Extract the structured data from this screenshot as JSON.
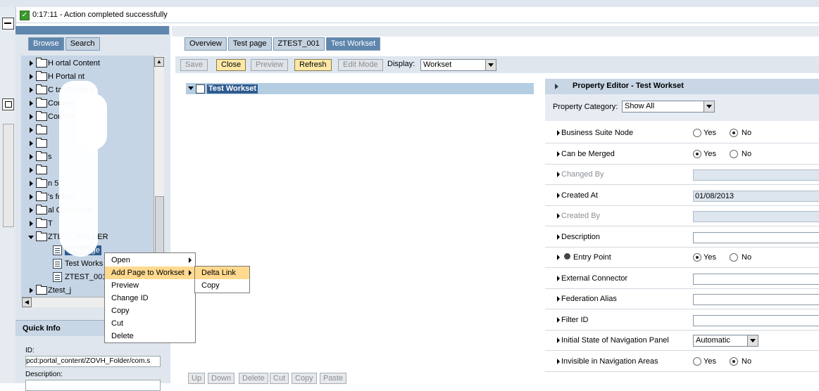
{
  "status": {
    "message": "0:17:11 - Action completed successfully"
  },
  "left_tabs": [
    "Browse",
    "Search"
  ],
  "tree": {
    "items": [
      {
        "label": "H    ortal Content",
        "type": "folder",
        "expanded": false
      },
      {
        "label": "H    Portal     nt",
        "type": "folder",
        "expanded": false
      },
      {
        "label": "      C     tal Content",
        "type": "folder",
        "expanded": false
      },
      {
        "label": "         Content",
        "type": "folder",
        "expanded": false
      },
      {
        "label": "             Content",
        "type": "folder",
        "expanded": false
      },
      {
        "label": "",
        "type": "folder",
        "expanded": false
      },
      {
        "label": "",
        "type": "folder",
        "expanded": false
      },
      {
        "label": "        s",
        "type": "folder",
        "expanded": false
      },
      {
        "label": "",
        "type": "folder",
        "expanded": false
      },
      {
        "label": "        n 5.0",
        "type": "folder",
        "expanded": false
      },
      {
        "label": "      's folder",
        "type": "folder",
        "expanded": false
      },
      {
        "label": "   al Composer",
        "type": "folder",
        "expanded": false
      },
      {
        "label": "              T",
        "type": "folder",
        "expanded": false
      },
      {
        "label": "ZTEST_FOLDER",
        "type": "folder",
        "expanded": true
      },
      {
        "label": "Test page",
        "type": "page",
        "selected": true
      },
      {
        "label": "Test Works",
        "type": "workset"
      },
      {
        "label": "ZTEST_001",
        "type": "iview"
      },
      {
        "label": "Ztest_j",
        "type": "folder",
        "expanded": false
      }
    ]
  },
  "quick_info": {
    "title": "Quick Info",
    "id_label": "ID:",
    "id_value": "pcd:portal_content/ZOVH_Folder/com.s",
    "desc_label": "Description:"
  },
  "context_menu": {
    "items": [
      "Open",
      "Add Page to Workset",
      "Preview",
      "Change ID",
      "Copy",
      "Cut",
      "Delete"
    ],
    "submenu": [
      "Delta Link",
      "Copy"
    ]
  },
  "right_tabs": [
    "Overview",
    "Test page",
    "ZTEST_001",
    "Test Workset"
  ],
  "toolbar": {
    "save": "Save",
    "close": "Close",
    "preview": "Preview",
    "refresh": "Refresh",
    "edit_mode": "Edit Mode",
    "display_label": "Display:",
    "display_value": "Workset"
  },
  "workset_tree": {
    "root": "Test Workset"
  },
  "bottom_buttons": [
    "Up",
    "Down",
    "Delete",
    "Cut",
    "Copy",
    "Paste"
  ],
  "property_editor": {
    "title": "Property Editor - Test Workset",
    "category_label": "Property Category:",
    "category_value": "Show All",
    "yes": "Yes",
    "no": "No",
    "rows": [
      {
        "label": "Business Suite Node",
        "kind": "radio",
        "value": "No"
      },
      {
        "label": "Can be Merged",
        "kind": "radio",
        "value": "Yes"
      },
      {
        "label": "Changed By",
        "kind": "readonly",
        "value": "",
        "grey": true
      },
      {
        "label": "Created At",
        "kind": "readonly",
        "value": "01/08/2013"
      },
      {
        "label": "Created By",
        "kind": "readonly",
        "value": "",
        "grey": true
      },
      {
        "label": "Description",
        "kind": "text",
        "value": ""
      },
      {
        "label": "Entry Point",
        "kind": "radio",
        "value": "Yes",
        "icon": true
      },
      {
        "label": "External Connector",
        "kind": "text",
        "value": ""
      },
      {
        "label": "Federation Alias",
        "kind": "text",
        "value": ""
      },
      {
        "label": "Filter ID",
        "kind": "text",
        "value": ""
      },
      {
        "label": "Initial State of Navigation Panel",
        "kind": "select",
        "value": "Automatic"
      },
      {
        "label": "Invisible in Navigation Areas",
        "kind": "radio",
        "value": "No"
      }
    ]
  }
}
